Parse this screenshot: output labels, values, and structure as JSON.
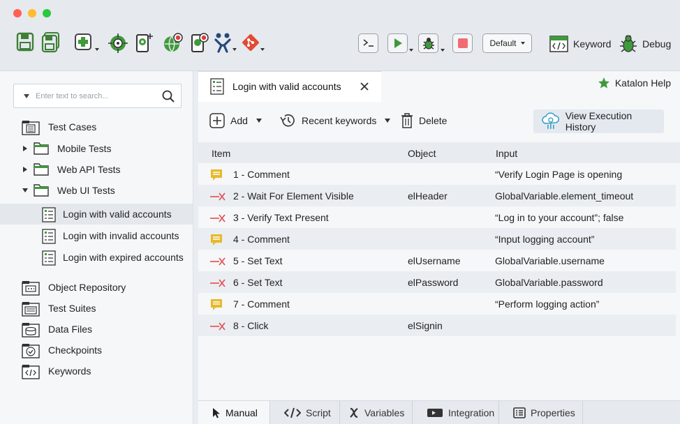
{
  "toolbar": {
    "profile": "Default",
    "keyword_label": "Keyword",
    "debug_label": "Debug"
  },
  "explorer": {
    "search_placeholder": "Enter text to search...",
    "tree": {
      "test_cases": "Test Cases",
      "mobile_tests": "Mobile Tests",
      "web_api_tests": "Web API Tests",
      "web_ui_tests": "Web UI Tests",
      "login_valid": "Login with valid accounts",
      "login_invalid": "Login with invalid accounts",
      "login_expired": "Login with expired accounts",
      "object_repository": "Object Repository",
      "test_suites": "Test Suites",
      "data_files": "Data Files",
      "checkpoints": "Checkpoints",
      "keywords": "Keywords"
    }
  },
  "editor": {
    "tab_title": "Login with valid accounts",
    "help_label": "Katalon Help",
    "actions": {
      "add": "Add",
      "recent": "Recent keywords",
      "delete": "Delete",
      "history": "View Execution History"
    },
    "columns": {
      "item": "Item",
      "object": "Object",
      "input": "Input"
    },
    "rows": [
      {
        "type": "comment",
        "item": "1 - Comment",
        "object": "",
        "input": "“Verify Login Page is opening"
      },
      {
        "type": "action",
        "item": "2 - Wait For Element Visible",
        "object": "elHeader",
        "input": "GlobalVariable.element_timeout"
      },
      {
        "type": "action",
        "item": "3 - Verify Text Present",
        "object": "",
        "input": "“Log in to your account”; false"
      },
      {
        "type": "comment",
        "item": "4 - Comment",
        "object": "",
        "input": "“Input logging account”"
      },
      {
        "type": "action",
        "item": "5 - Set Text",
        "object": "elUsername",
        "input": "GlobalVariable.username"
      },
      {
        "type": "action",
        "item": "6 - Set Text",
        "object": "elPassword",
        "input": "GlobalVariable.password"
      },
      {
        "type": "comment",
        "item": "7 - Comment",
        "object": "",
        "input": "“Perform logging action”"
      },
      {
        "type": "action",
        "item": "8 - Click",
        "object": "elSignin",
        "input": ""
      }
    ],
    "bottom_tabs": {
      "manual": "Manual",
      "script": "Script",
      "variables": "Variables",
      "integration": "Integration",
      "properties": "Properties"
    }
  },
  "colors": {
    "accent_green": "#3f9a3b",
    "comment_yellow": "#e7b92b",
    "action_red": "#e24d4d",
    "stop_red": "#f26b74"
  }
}
